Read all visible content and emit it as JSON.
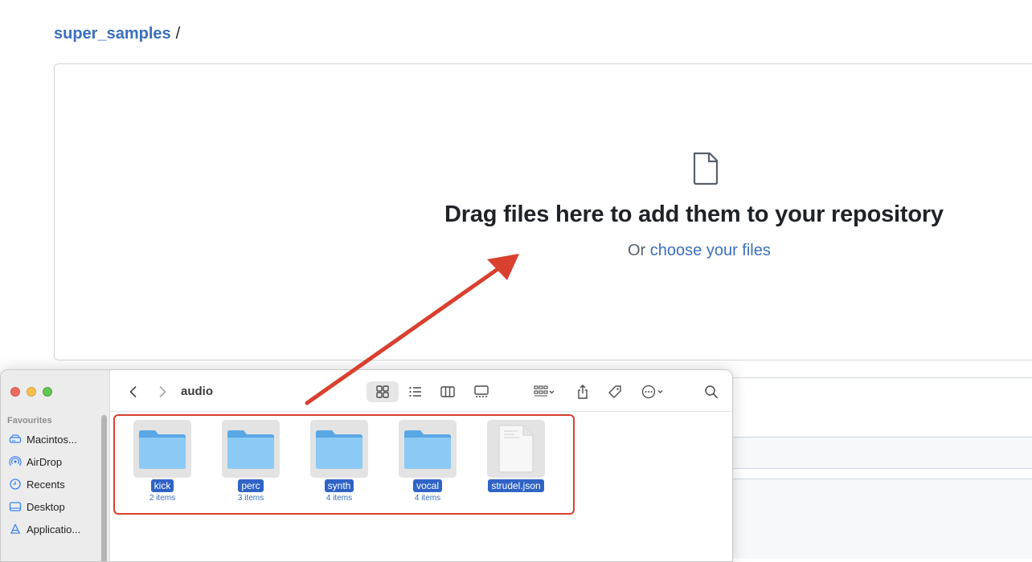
{
  "breadcrumb": {
    "repo": "super_samples",
    "separator": "/"
  },
  "dropzone": {
    "title": "Drag files here to add them to your repository",
    "subtitle_prefix": "Or",
    "subtitle_link": "choose your files"
  },
  "finder": {
    "folder_title": "audio",
    "sidebar": {
      "heading": "Favourites",
      "items": [
        {
          "label": "Macintos...",
          "icon": "hard-drive-icon"
        },
        {
          "label": "AirDrop",
          "icon": "airdrop-icon"
        },
        {
          "label": "Recents",
          "icon": "clock-icon"
        },
        {
          "label": "Desktop",
          "icon": "desktop-icon"
        },
        {
          "label": "Applicatio...",
          "icon": "applications-icon"
        }
      ]
    },
    "items": [
      {
        "name": "kick",
        "count": "2 items",
        "kind": "folder"
      },
      {
        "name": "perc",
        "count": "3 items",
        "kind": "folder"
      },
      {
        "name": "synth",
        "count": "4 items",
        "kind": "folder"
      },
      {
        "name": "vocal",
        "count": "4 items",
        "kind": "folder"
      },
      {
        "name": "strudel.json",
        "count": "",
        "kind": "file"
      }
    ]
  },
  "colors": {
    "link": "#3b6fc0",
    "annotation": "#d9402f",
    "selection": "#2f63c6",
    "folder": "#6cb4ee"
  }
}
